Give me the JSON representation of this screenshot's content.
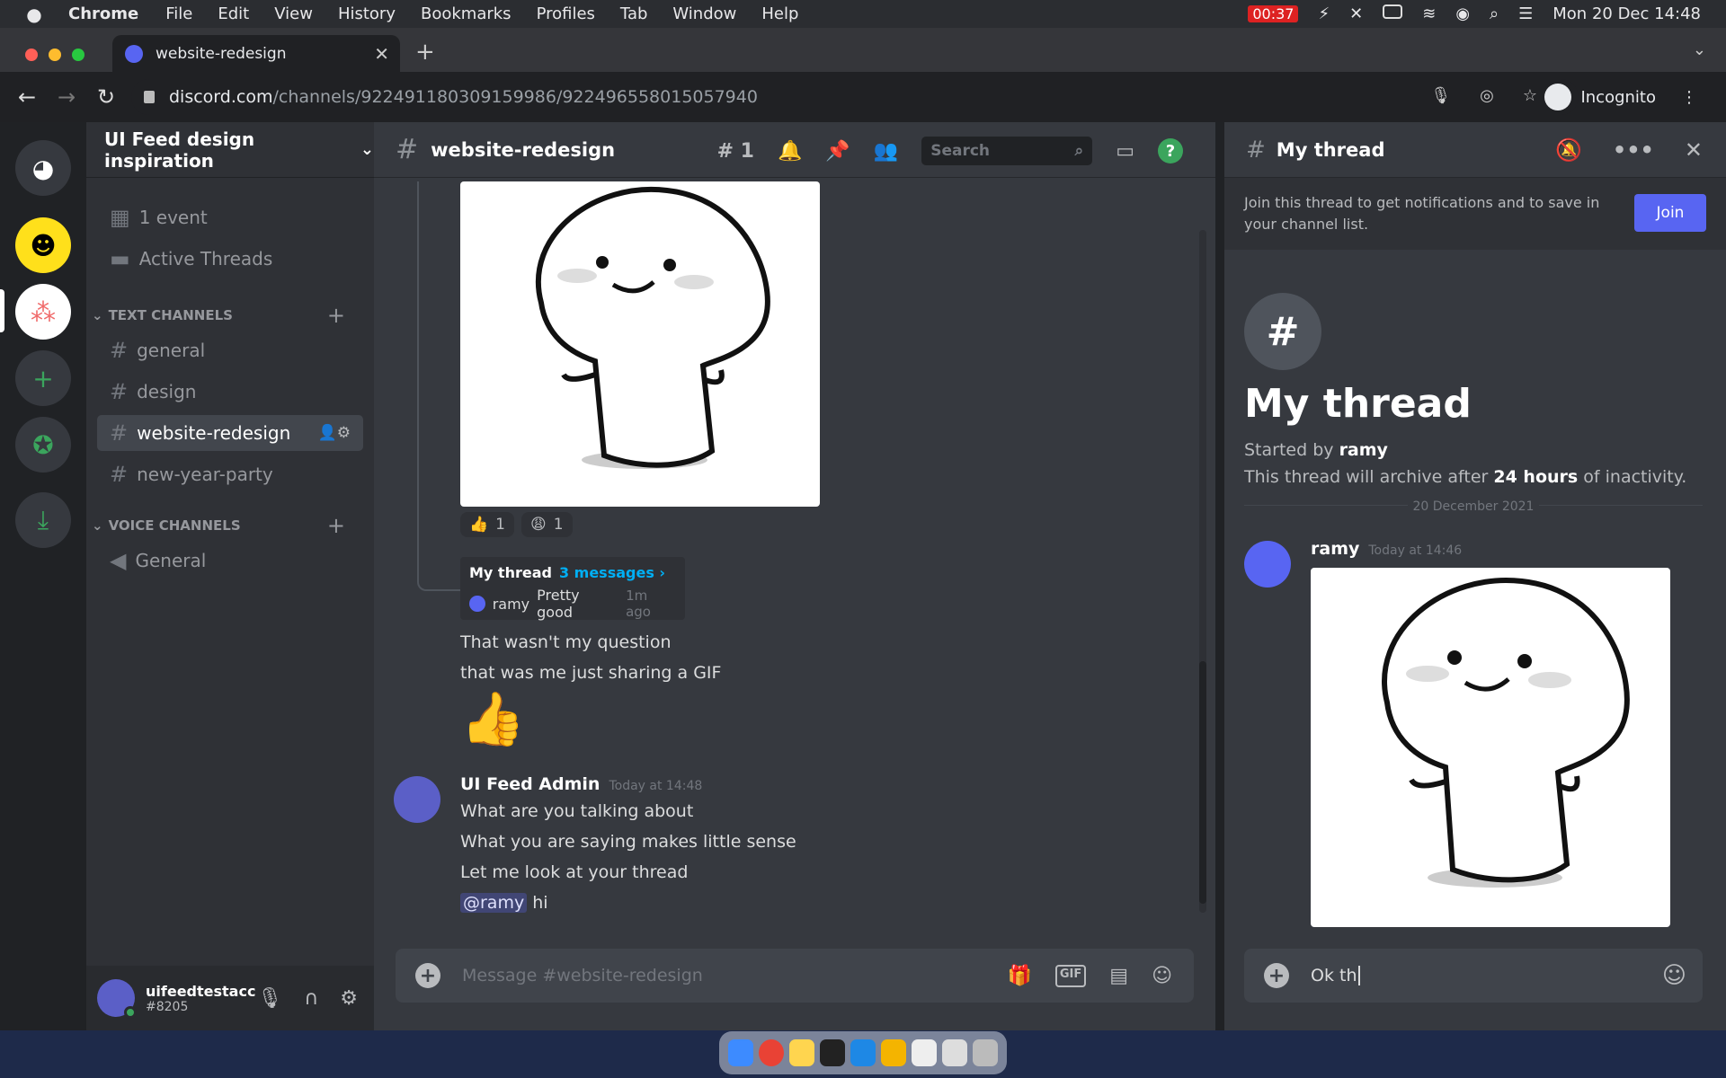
{
  "menubar": {
    "app": "Chrome",
    "items": [
      "File",
      "Edit",
      "View",
      "History",
      "Bookmarks",
      "Profiles",
      "Tab",
      "Window",
      "Help"
    ],
    "battery_time": "00:37",
    "datetime": "Mon 20 Dec  14:48"
  },
  "browser": {
    "tab_title": "website-redesign",
    "url_host": "discord.com",
    "url_path": "/channels/922491180309159986/922496558015057940",
    "profile": "Incognito"
  },
  "server": {
    "name": "UI Feed design inspiration",
    "event": "1 event",
    "active_threads": "Active Threads",
    "text_category": "TEXT CHANNELS",
    "text_channels": [
      "general",
      "design",
      "website-redesign",
      "new-year-party"
    ],
    "voice_category": "VOICE CHANNELS",
    "voice_channels": [
      "General"
    ]
  },
  "user": {
    "name": "uifeedtestacc",
    "tag": "#8205"
  },
  "channel": {
    "name": "website-redesign",
    "threads_count": "1",
    "search_placeholder": "Search",
    "message_placeholder": "Message #website-redesign"
  },
  "chat": {
    "reactions": [
      {
        "emoji": "👍",
        "count": "1"
      },
      {
        "emoji": "😩",
        "count": "1"
      }
    ],
    "thread_card": {
      "name": "My thread",
      "messages": "3 messages ›",
      "author": "ramy",
      "preview": "Pretty good",
      "ago": "1m ago"
    },
    "lines_before": [
      "That wasn't my question",
      "that was me just sharing a GIF"
    ],
    "admin": {
      "author": "UI Feed Admin",
      "time": "Today at 14:48",
      "lines": [
        "What are you talking about",
        "What you are saying makes little sense",
        "Let me look at your thread"
      ],
      "mention": "@ramy",
      "mention_rest": " hi"
    }
  },
  "thread": {
    "title": "My thread",
    "join_text": "Join this thread to get notifications and to save in your channel list.",
    "join_button": "Join",
    "started_by_label": "Started by",
    "started_by": "ramy",
    "archive_pre": "This thread will archive after",
    "archive_hours": "24 hours",
    "archive_post": "of inactivity.",
    "date": "20 December 2021",
    "message": {
      "author": "ramy",
      "time": "Today at 14:46"
    },
    "input_value": "Ok th"
  },
  "colors": {
    "blurple": "#5865f2",
    "green": "#3ba55d",
    "bg": "#36393f"
  }
}
